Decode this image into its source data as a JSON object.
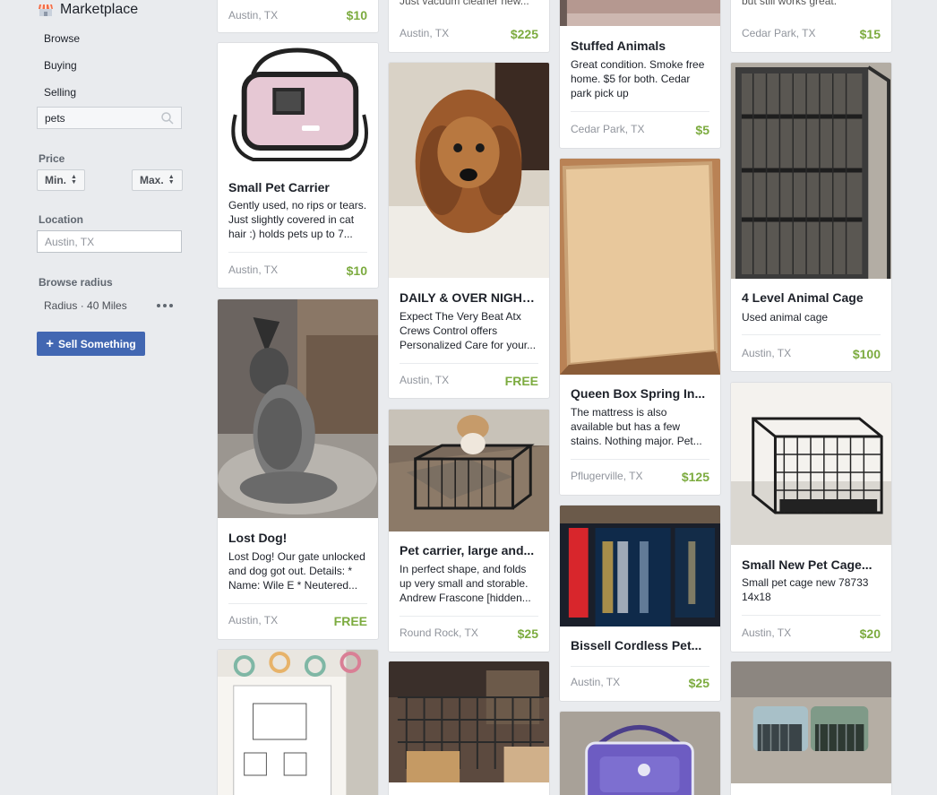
{
  "sidebar": {
    "title": "Marketplace",
    "nav": [
      "Browse",
      "Buying",
      "Selling"
    ],
    "search_value": "pets",
    "price_label": "Price",
    "min_label": "Min.",
    "max_label": "Max.",
    "location_label": "Location",
    "location_placeholder": "Austin, TX",
    "radius_label": "Browse radius",
    "radius_value": "Radius · 40 Miles",
    "sell_button": "Sell Something"
  },
  "colors": {
    "accent": "#4267b2",
    "price": "#7cab3f"
  },
  "listings": {
    "c1_top": {
      "location": "Austin, TX",
      "price": "$10"
    },
    "carrier": {
      "title": "Small Pet Carrier",
      "description": "Gently used, no rips or tears. Just slightly covered in cat hair :) holds pets up to 7...",
      "location": "Austin, TX",
      "price": "$10"
    },
    "lost_dog": {
      "title": "Lost Dog!",
      "description": "Lost Dog! Our gate unlocked and dog got out. Details: * Name: Wile E * Neutered...",
      "location": "Austin, TX",
      "price": "FREE"
    },
    "c2_top": {
      "description": "Just vacuum cleaner new...",
      "location": "Austin, TX",
      "price": "$225"
    },
    "daily": {
      "title": "DAILY & OVER NIGHT...",
      "description": "Expect The Very Beat Atx Crews Control offers Personalized Care for your...",
      "location": "Austin, TX",
      "price": "FREE"
    },
    "pet_carrier": {
      "title": "Pet carrier, large and...",
      "description": "In perfect shape, and folds up very small and storable. Andrew Frascone [hidden...",
      "location": "Round Rock, TX",
      "price": "$25"
    },
    "stuffed": {
      "title": "Stuffed Animals",
      "description": "Great condition. Smoke free home. $5 for both. Cedar park pick up",
      "location": "Cedar Park, TX",
      "price": "$5"
    },
    "queen": {
      "title": "Queen Box Spring In...",
      "description": "The mattress is also available but has a few stains. Nothing major. Pet...",
      "location": "Pflugerville, TX",
      "price": "$125"
    },
    "bissell": {
      "title": "Bissell Cordless Pet...",
      "location": "Austin, TX",
      "price": "$25"
    },
    "c4_top": {
      "description": "but still works great. Scratch...",
      "location": "Cedar Park, TX",
      "price": "$15"
    },
    "cage4": {
      "title": "4 Level Animal Cage",
      "description": "Used animal cage",
      "location": "Austin, TX",
      "price": "$100"
    },
    "small_cage": {
      "title": "Small New Pet Cage...",
      "description": "Small pet cage new 78733 14x18",
      "location": "Austin, TX",
      "price": "$20"
    }
  }
}
